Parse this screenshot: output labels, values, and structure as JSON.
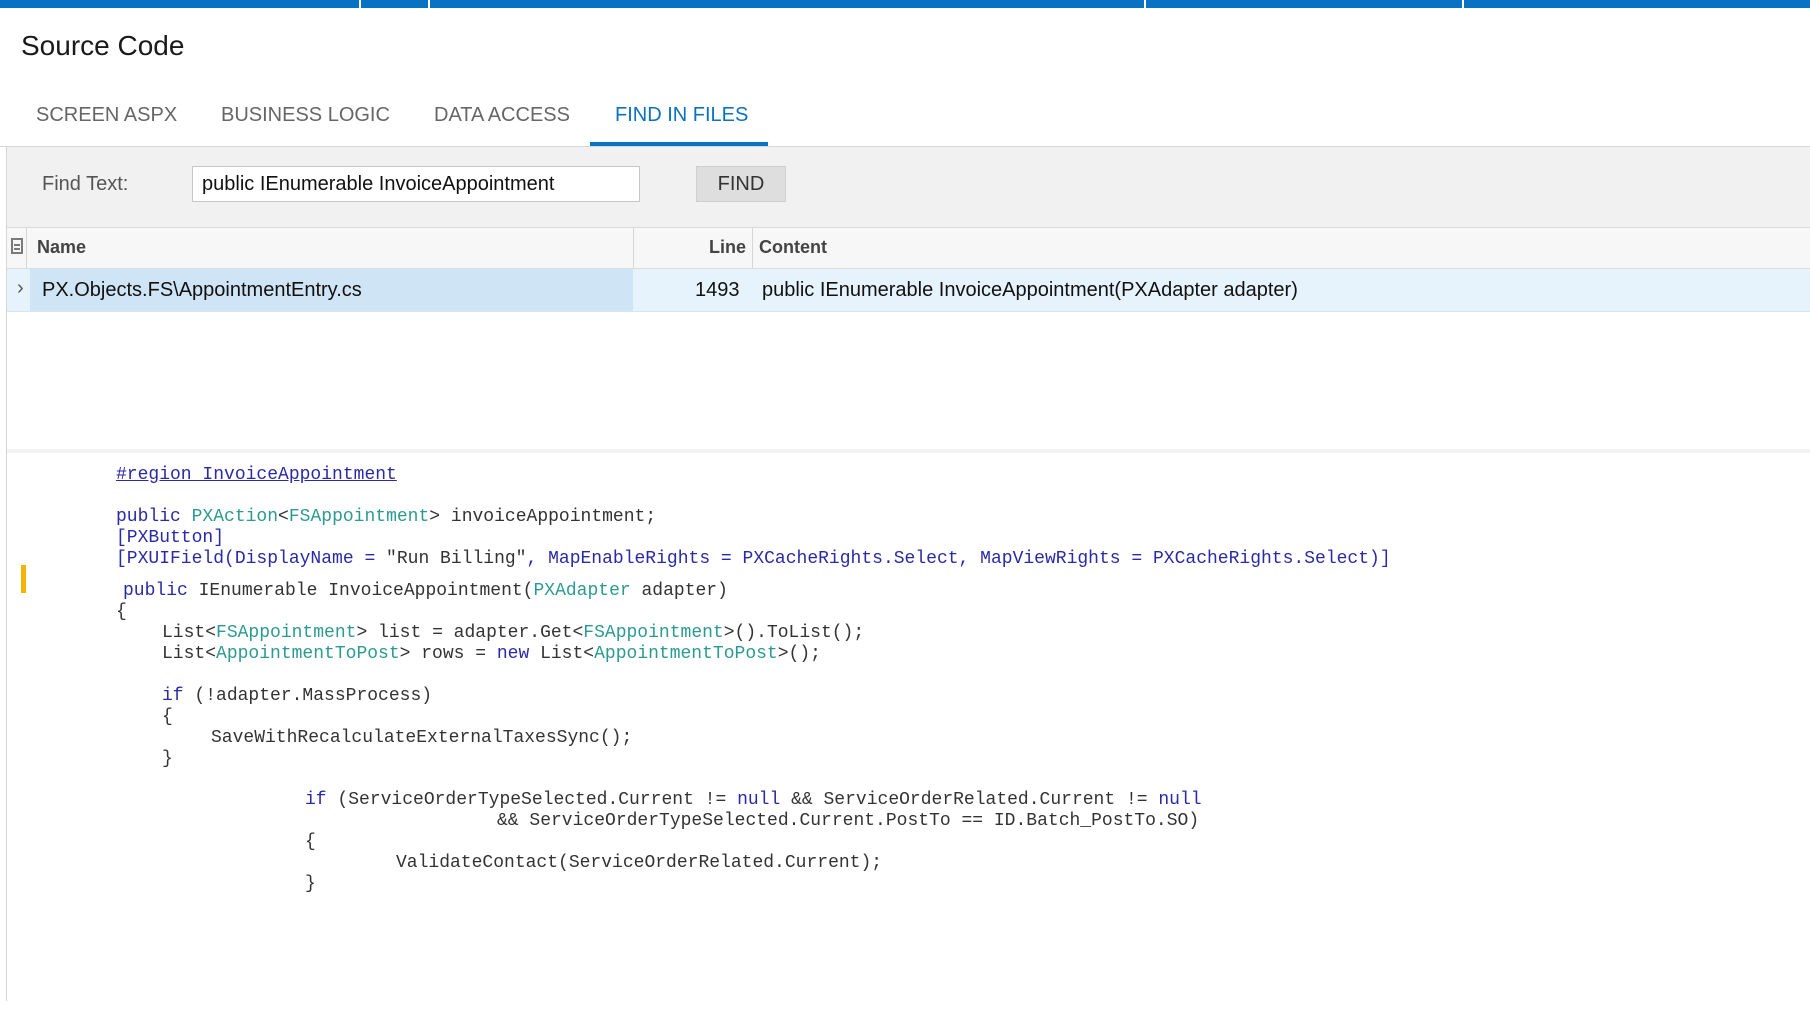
{
  "page": {
    "title": "Source Code"
  },
  "tabs": [
    {
      "label": "SCREEN ASPX",
      "active": false
    },
    {
      "label": "BUSINESS LOGIC",
      "active": false
    },
    {
      "label": "DATA ACCESS",
      "active": false
    },
    {
      "label": "FIND IN FILES",
      "active": true
    }
  ],
  "find": {
    "label": "Find Text:",
    "value": "public IEnumerable InvoiceAppointment",
    "button": "FIND"
  },
  "grid": {
    "columns": {
      "name": "Name",
      "line": "Line",
      "content": "Content"
    },
    "rows": [
      {
        "name": "PX.Objects.FS\\AppointmentEntry.cs",
        "line": "1493",
        "content": "public IEnumerable InvoiceAppointment(PXAdapter adapter)"
      }
    ]
  },
  "code": {
    "region": "#region InvoiceAppointment",
    "line_action_kw": "public",
    "line_action_type1": "PXAction",
    "line_action_type2": "FSAppointment",
    "line_action_rest": "> invoiceAppointment;",
    "line_button": "[PXButton]",
    "line_uifield_1": "[PXUIField(DisplayName = ",
    "line_uifield_str": "\"Run Billing\"",
    "line_uifield_2": ", MapEnableRights = PXCacheRights.Select, MapViewRights = PXCacheRights.Select)]",
    "line_method_kw": "public",
    "line_method_1": " IEnumerable InvoiceAppointment(",
    "line_method_type": "PXAdapter",
    "line_method_2": " adapter)",
    "brace_open": "{",
    "brace_close": "}",
    "list_1": "List<",
    "list_type": "FSAppointment",
    "list_2": "> list = adapter.Get<",
    "list_type2": "FSAppointment",
    "list_3": ">().ToList();",
    "rows_1": "List<",
    "rows_type": "AppointmentToPost",
    "rows_2": "> rows = ",
    "rows_kw": "new",
    "rows_3": " List<",
    "rows_type2": "AppointmentToPost",
    "rows_4": ">();",
    "if_kw": "if",
    "if_rest": " (!adapter.MassProcess)",
    "save_call": "SaveWithRecalculateExternalTaxesSync();",
    "if2_kw": "if",
    "if2_1": " (ServiceOrderTypeSelected.Current != ",
    "if2_null1": "null",
    "if2_2": " && ServiceOrderRelated.Current != ",
    "if2_null2": "null",
    "if2_cont": "&& ServiceOrderTypeSelected.Current.PostTo == ID.Batch_PostTo.SO)",
    "validate_call": "ValidateContact(ServiceOrderRelated.Current);"
  },
  "colors": {
    "accent": "#0a72c2",
    "selected_row": "#e6f3fc",
    "marker": "#f4b400"
  }
}
